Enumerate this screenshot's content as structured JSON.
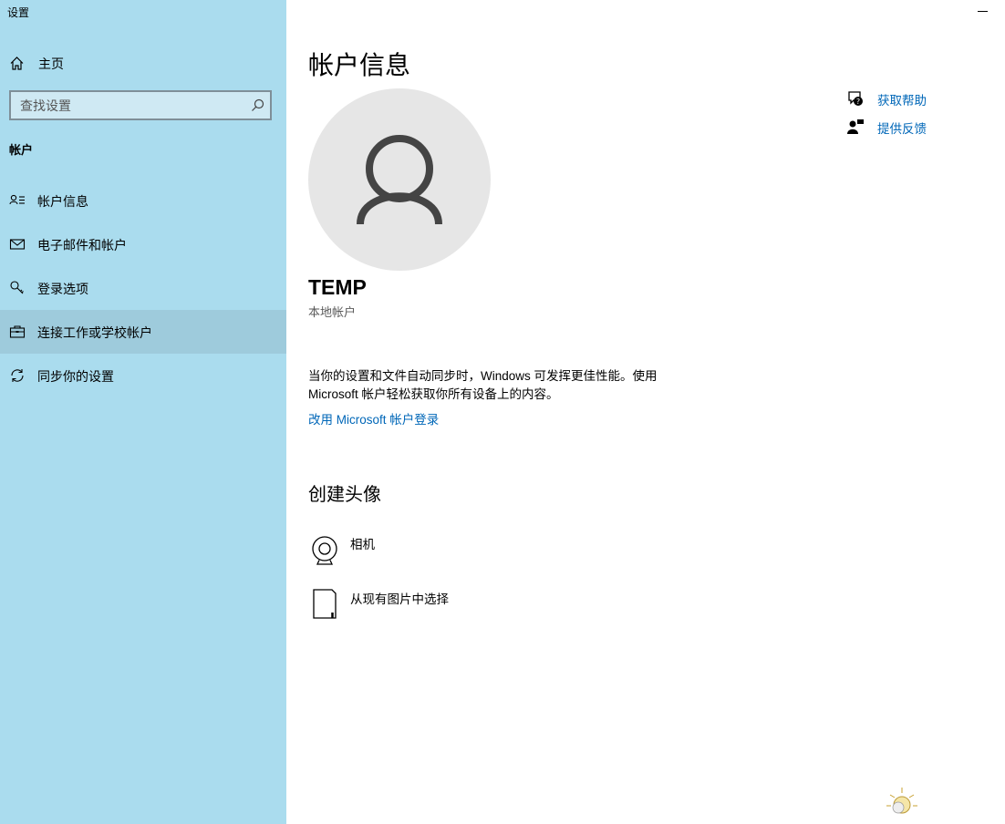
{
  "window": {
    "app_title": "设置"
  },
  "sidebar": {
    "home_label": "主页",
    "search_placeholder": "查找设置",
    "section_label": "帐户",
    "items": [
      {
        "label": "帐户信息",
        "icon": "person-list-icon"
      },
      {
        "label": "电子邮件和帐户",
        "icon": "mail-icon"
      },
      {
        "label": "登录选项",
        "icon": "key-icon"
      },
      {
        "label": "连接工作或学校帐户",
        "icon": "briefcase-icon",
        "selected": true
      },
      {
        "label": "同步你的设置",
        "icon": "sync-icon"
      }
    ]
  },
  "main": {
    "page_title": "帐户信息",
    "user": {
      "name": "TEMP",
      "account_type": "本地帐户"
    },
    "sync_description": "当你的设置和文件自动同步时，Windows 可发挥更佳性能。使用 Microsoft 帐户轻松获取你所有设备上的内容。",
    "signin_link": "改用 Microsoft 帐户登录",
    "create_avatar_title": "创建头像",
    "avatar_options": [
      {
        "label": "相机",
        "icon": "camera-icon"
      },
      {
        "label": "从现有图片中选择",
        "icon": "file-icon"
      }
    ],
    "help_links": [
      {
        "label": "获取帮助",
        "icon": "help-chat-icon"
      },
      {
        "label": "提供反馈",
        "icon": "feedback-icon"
      }
    ]
  },
  "colors": {
    "sidebar_bg": "#aadcee",
    "selected_bg": "#9ecbdc",
    "link": "#0067b8"
  }
}
